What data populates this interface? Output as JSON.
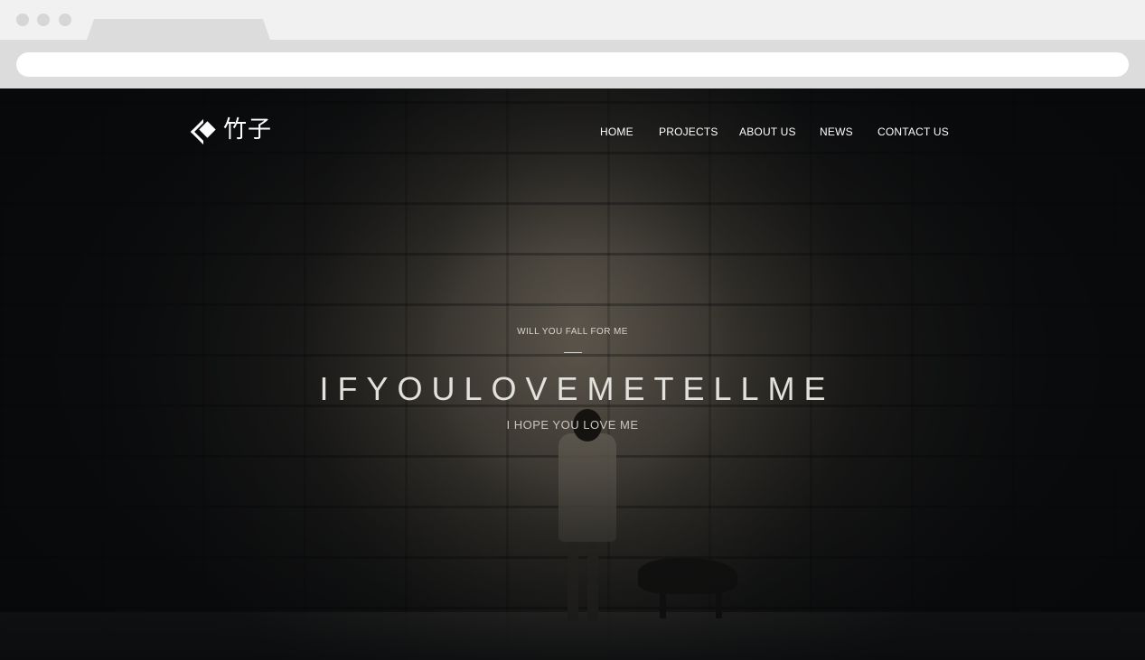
{
  "site": {
    "logo_text": "竹子"
  },
  "nav": {
    "items": [
      {
        "label": "HOME"
      },
      {
        "label": "PROJECTS"
      },
      {
        "label": "ABOUT US"
      },
      {
        "label": "NEWS"
      },
      {
        "label": "CONTACT US"
      }
    ]
  },
  "hero": {
    "kicker": "WILL YOU FALL FOR ME",
    "headline": "IFYOULOVEMETELLME",
    "subhead": "I HOPE YOU LOVE ME"
  },
  "colors": {
    "nav_text": "#ffffff",
    "headline_text": "#e3e1dc",
    "chrome_bar": "#dcdcdc",
    "hero_dark": "#0d0d0e"
  },
  "icons": {
    "logo": "diamond-logo-icon"
  }
}
